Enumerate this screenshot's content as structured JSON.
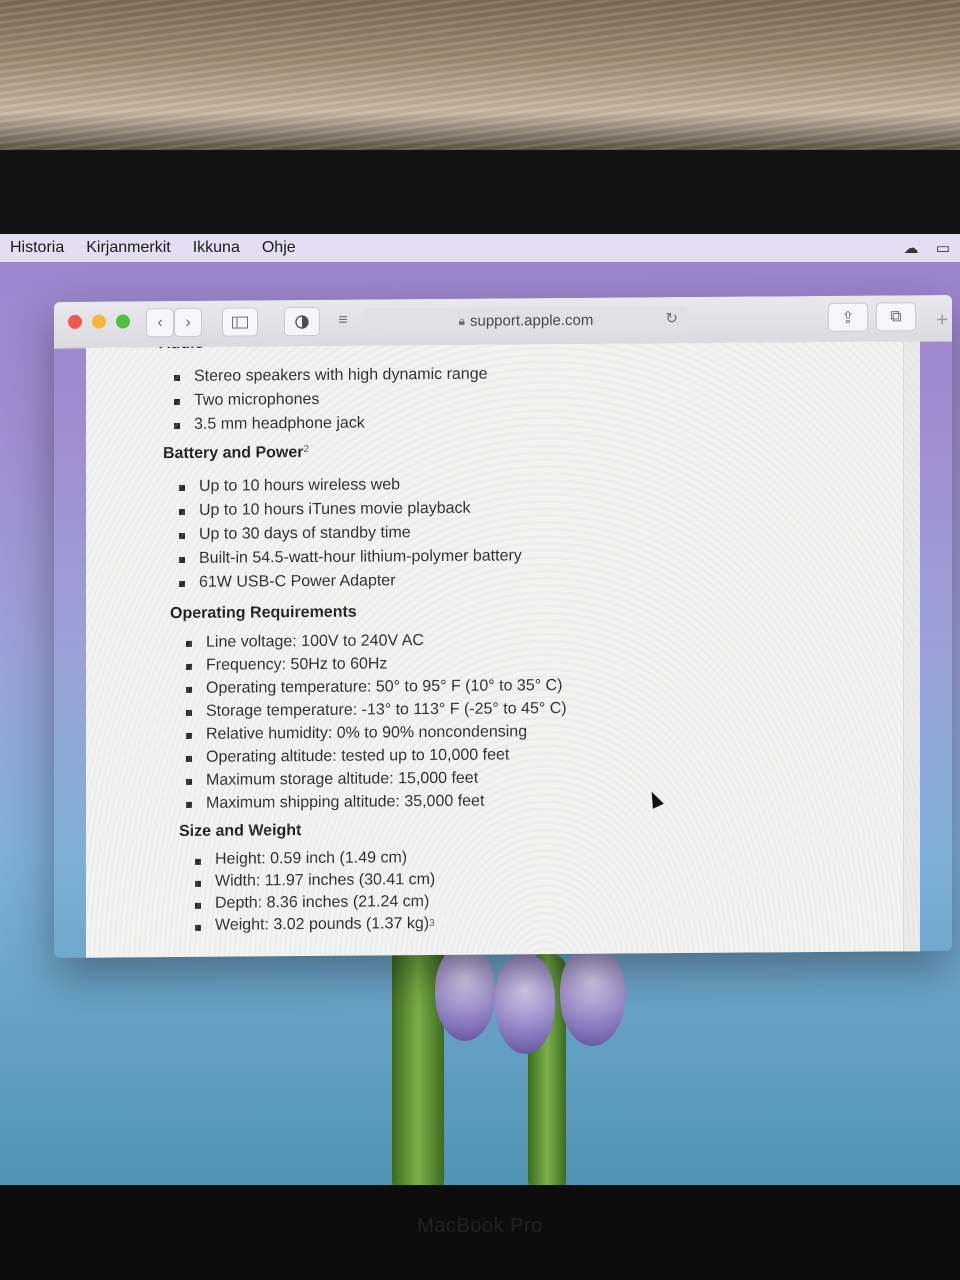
{
  "menubar": {
    "items": [
      "Historia",
      "Kirjanmerkit",
      "Ikkuna",
      "Ohje"
    ]
  },
  "browser": {
    "url": "support.apple.com"
  },
  "specs": {
    "audio": {
      "heading": "Audio",
      "items": [
        "Stereo speakers with high dynamic range",
        "Two microphones",
        "3.5 mm headphone jack"
      ]
    },
    "battery": {
      "heading": "Battery and Power",
      "footnote": "2",
      "items": [
        "Up to 10 hours wireless web",
        "Up to 10 hours iTunes movie playback",
        "Up to 30 days of standby time",
        "Built-in 54.5-watt-hour lithium-polymer battery",
        "61W USB-C Power Adapter"
      ]
    },
    "operating": {
      "heading": "Operating Requirements",
      "items": [
        "Line voltage: 100V to 240V AC",
        "Frequency: 50Hz to 60Hz",
        "Operating temperature: 50° to 95° F (10° to 35° C)",
        "Storage temperature: -13° to 113° F (-25° to 45° C)",
        "Relative humidity: 0% to 90% noncondensing",
        "Operating altitude: tested up to 10,000 feet",
        "Maximum storage altitude: 15,000 feet",
        "Maximum shipping altitude: 35,000 feet"
      ]
    },
    "size": {
      "heading": "Size and Weight",
      "items": [
        "Height: 0.59 inch (1.49 cm)",
        "Width: 11.97 inches (30.41 cm)",
        "Depth: 8.36 inches (21.24 cm)",
        "Weight: 3.02 pounds (1.37 kg)"
      ],
      "weight_footnote": "3"
    }
  },
  "device_label": "MacBook Pro",
  "colors": {
    "close": "#ee5a4f",
    "minimize": "#f3b83a",
    "maximize": "#52bf3f"
  }
}
